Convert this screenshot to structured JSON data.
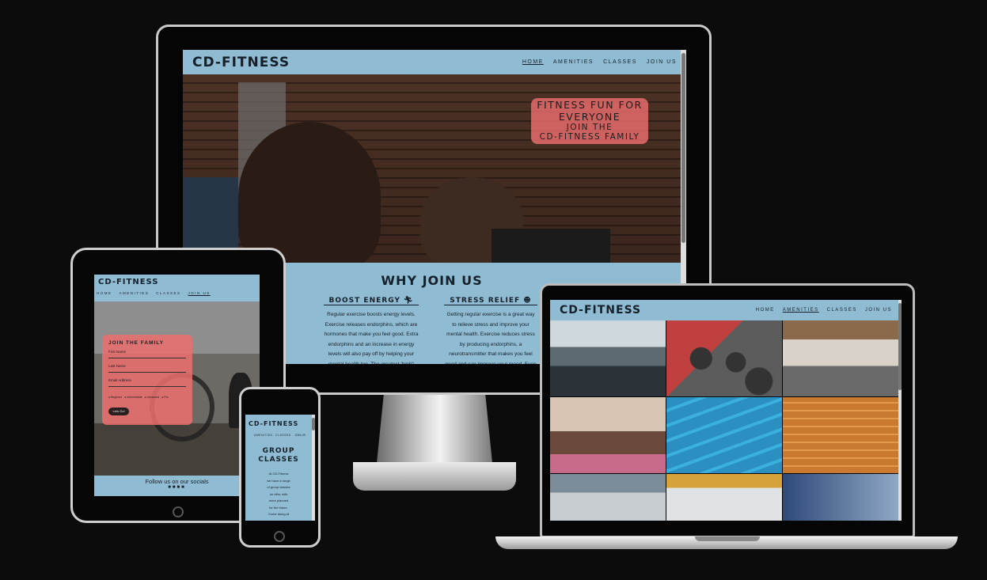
{
  "desktop": {
    "brand": "CD-FITNESS",
    "nav": [
      "HOME",
      "AMENITIES",
      "CLASSES",
      "JOIN US"
    ],
    "hero_line1": "FITNESS FUN FOR",
    "hero_line2": "EVERYONE",
    "hero_line3": "JOIN THE",
    "hero_line4": "CD-FITNESS FAMILY",
    "why_title": "WHY JOIN US",
    "features": [
      {
        "title": "BOOST ENERGY",
        "text": "Regular exercise boosts energy levels. Exercise releases endorphins, which are hormones that make you feel good. Extra endorphins and an increase in energy levels will also pay off by helping your mental health too. The greatest 'high'!"
      },
      {
        "title": "STRESS RELIEF",
        "text": "Getting regular exercise is a great way to relieve stress and improve your mental health. Exercise reduces stress by producing endorphins, a neurotransmitter that makes you feel good and can improve your mood. Even a"
      }
    ]
  },
  "tablet": {
    "brand": "CD-FITNESS",
    "nav": [
      "HOME",
      "AMENITIES",
      "CLASSES",
      "JOIN US"
    ],
    "form_title": "JOIN THE FAMILY",
    "fields": [
      "First Name",
      "Last Name",
      "Email Address"
    ],
    "options": [
      "Beginner",
      "Intermediate",
      "Advanced",
      "Pro"
    ],
    "submit": "Lets Go!",
    "footer": "Follow us on our socials"
  },
  "phone": {
    "brand": "CD-FITNESS",
    "nav": [
      "AMENITIES",
      "CLASSES",
      "JOIN US"
    ],
    "title_line1": "GROUP",
    "title_line2": "CLASSES",
    "text": [
      "At CD-Fitness",
      "we have a range",
      "of group classes",
      "on offer, with",
      "more planned",
      "for the future.",
      "Come along at"
    ]
  },
  "laptop": {
    "brand": "CD-FITNESS",
    "nav": [
      "HOME",
      "AMENITIES",
      "CLASSES",
      "JOIN US"
    ]
  }
}
